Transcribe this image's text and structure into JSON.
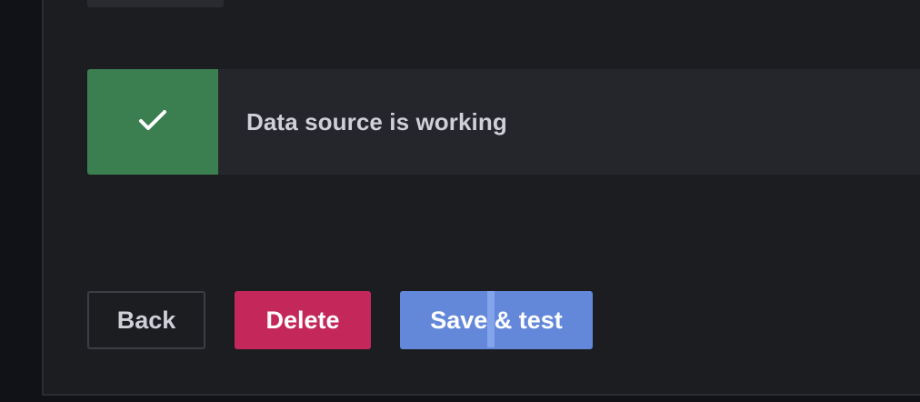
{
  "alert": {
    "status": "success",
    "icon": "check-icon",
    "message": "Data source is working",
    "color": "#3b7f51"
  },
  "buttons": {
    "back_label": "Back",
    "delete_label": "Delete",
    "save_test_label": "Save & test"
  },
  "colors": {
    "delete": "#c4285b",
    "primary": "#6488d9",
    "success": "#3b7f51"
  }
}
